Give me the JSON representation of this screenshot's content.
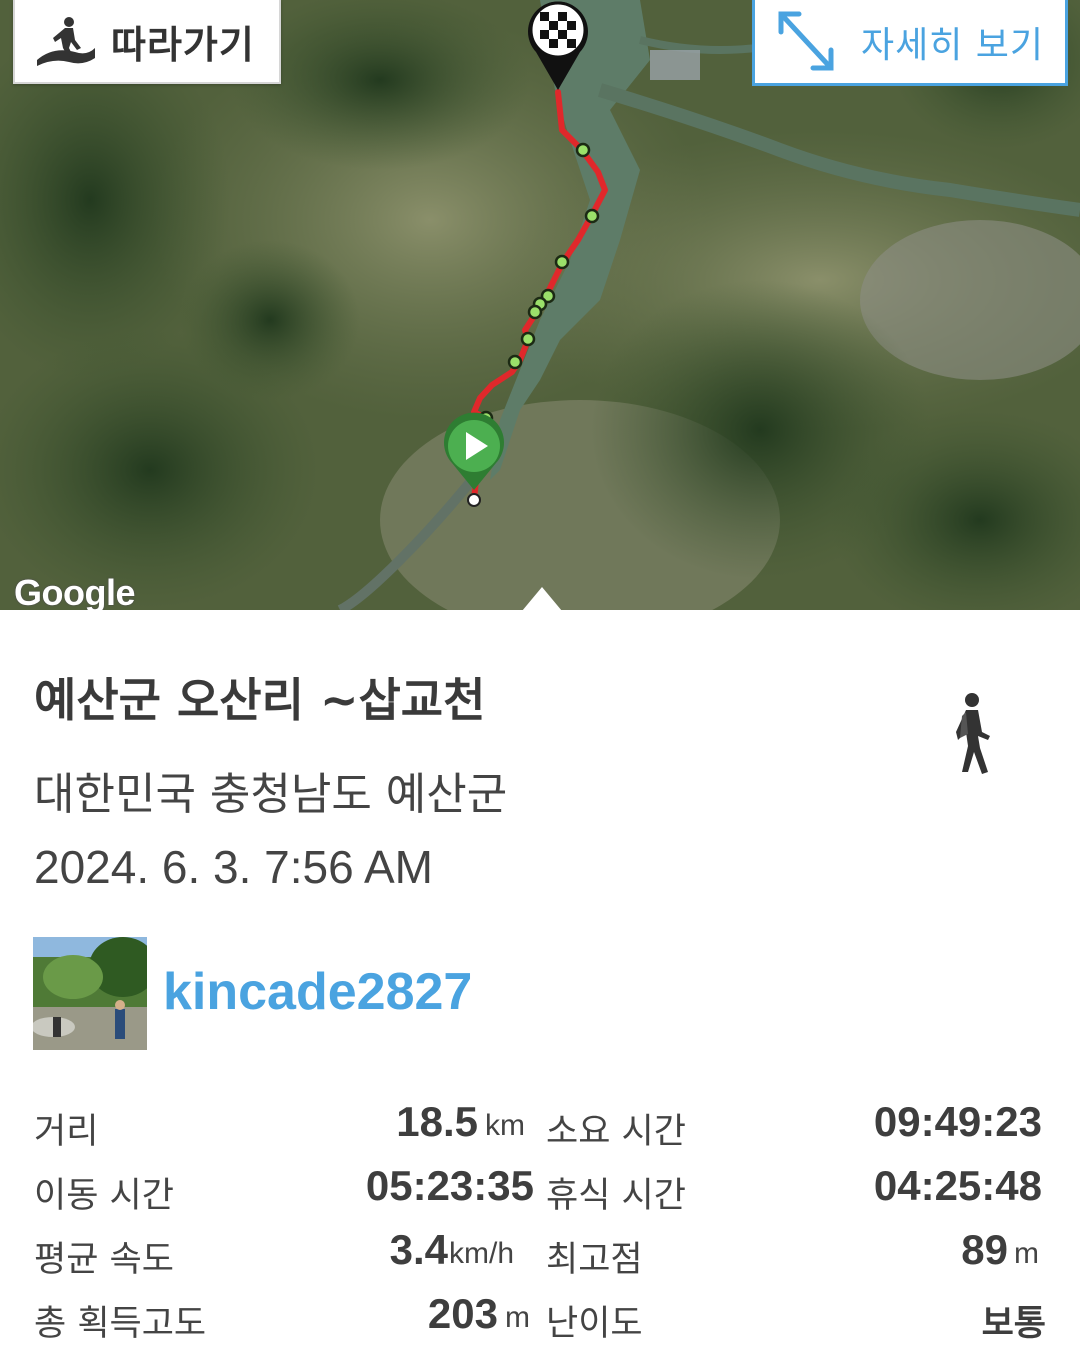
{
  "map": {
    "follow_button_label": "따라가기",
    "detail_button_label": "자세히 보기",
    "google_logo": "Google",
    "route_color": "#e0282b",
    "start_marker_color": "#4caf50",
    "waypoint_color": "#9be06a"
  },
  "track": {
    "title": "예산군 오산리 ~삽교천",
    "region": "대한민국 충청남도 예산군",
    "datetime": "2024. 6. 3. 7:56 AM",
    "activity_icon": "walker-icon"
  },
  "user": {
    "name": "kincade2827"
  },
  "stats": {
    "distance": {
      "label": "거리",
      "value": "18.5",
      "unit": "km"
    },
    "total_time": {
      "label": "소요 시간",
      "value": "09:49:23"
    },
    "moving_time": {
      "label": "이동 시간",
      "value": "05:23:35"
    },
    "rest_time": {
      "label": "휴식 시간",
      "value": "04:25:48"
    },
    "avg_speed": {
      "label": "평균 속도",
      "value": "3.4",
      "unit": "km/h"
    },
    "max_elevation": {
      "label": "최고점",
      "value": "89",
      "unit": "m"
    },
    "total_ascent": {
      "label": "총 획득고도",
      "value": "203",
      "unit": "m"
    },
    "difficulty": {
      "label": "난이도",
      "value": "보통"
    }
  },
  "colors": {
    "accent": "#4aa3e0",
    "text": "#333333"
  }
}
